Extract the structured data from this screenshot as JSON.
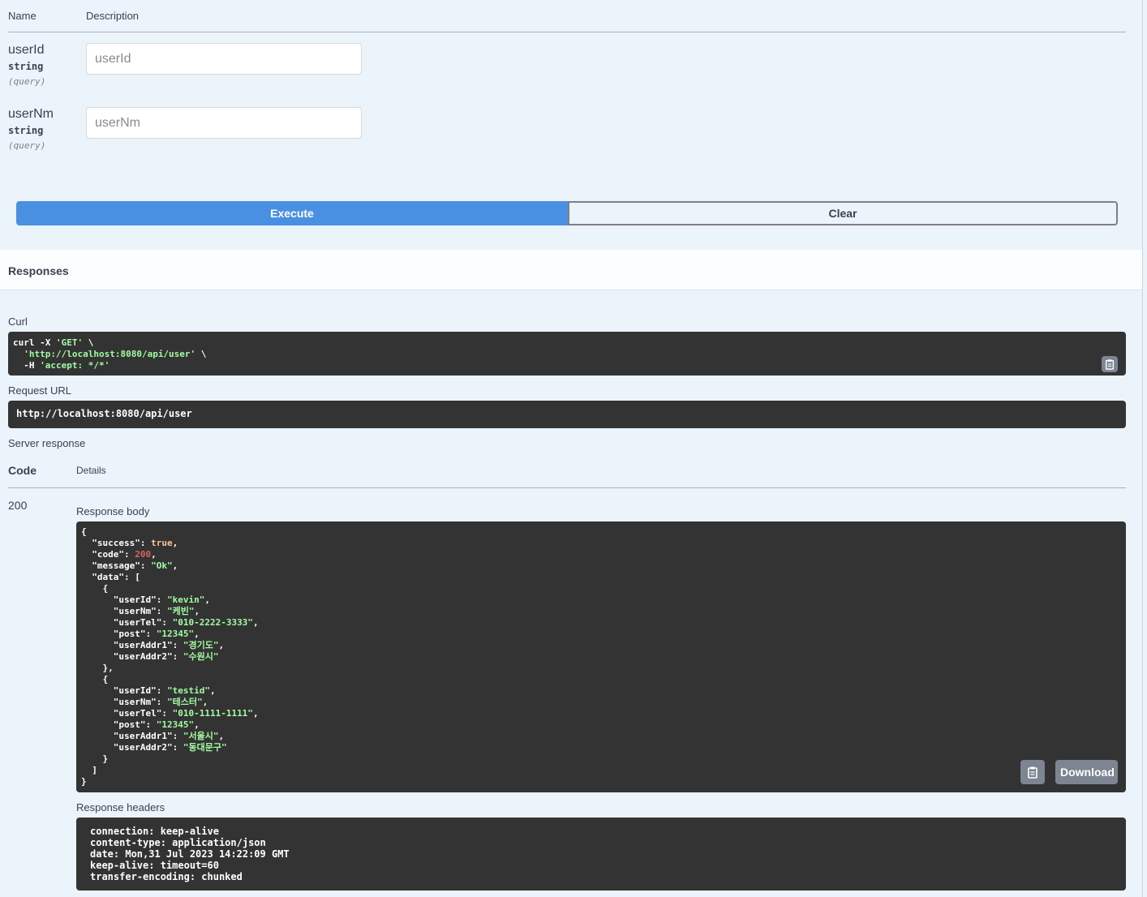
{
  "parameters": {
    "header_name": "Name",
    "header_description": "Description",
    "items": [
      {
        "name": "userId",
        "type": "string",
        "in": "(query)",
        "placeholder": "userId",
        "value": ""
      },
      {
        "name": "userNm",
        "type": "string",
        "in": "(query)",
        "placeholder": "userNm",
        "value": ""
      }
    ]
  },
  "actions": {
    "execute_label": "Execute",
    "clear_label": "Clear"
  },
  "responses": {
    "title": "Responses",
    "curl_label": "Curl",
    "curl_lines": [
      {
        "pre": "curl -X ",
        "str": "'GET'",
        "post": " \\"
      },
      {
        "pre": "  ",
        "str": "'http://localhost:8080/api/user'",
        "post": " \\"
      },
      {
        "pre": "  -H ",
        "str": "'accept: */*'",
        "post": ""
      }
    ],
    "request_url_label": "Request URL",
    "request_url": "http://localhost:8080/api/user",
    "server_response_label": "Server response",
    "code_header": "Code",
    "details_header": "Details",
    "status_code": "200",
    "response_body_label": "Response body",
    "download_label": "Download",
    "response_headers_label": "Response headers",
    "response_headers": [
      "connection: keep-alive",
      "content-type: application/json",
      "date: Mon,31 Jul 2023 14:22:09 GMT",
      "keep-alive: timeout=60",
      "transfer-encoding: chunked"
    ]
  },
  "response_body": {
    "success": true,
    "code": 200,
    "message": "Ok",
    "data": [
      {
        "userId": "kevin",
        "userNm": "케빈",
        "userTel": "010-2222-3333",
        "post": "12345",
        "userAddr1": "경기도",
        "userAddr2": "수원시"
      },
      {
        "userId": "testid",
        "userNm": "테스터",
        "userTel": "010-1111-1111",
        "post": "12345",
        "userAddr1": "서울시",
        "userAddr2": "동대문구"
      }
    ]
  },
  "icons": {
    "copy": "clipboard-icon"
  },
  "colors": {
    "execute": "#4990e2",
    "code_bg": "#333333",
    "string": "#a2fca2",
    "number": "#d36363",
    "boolean": "#fcc28c",
    "background": "#ebf3fb"
  }
}
